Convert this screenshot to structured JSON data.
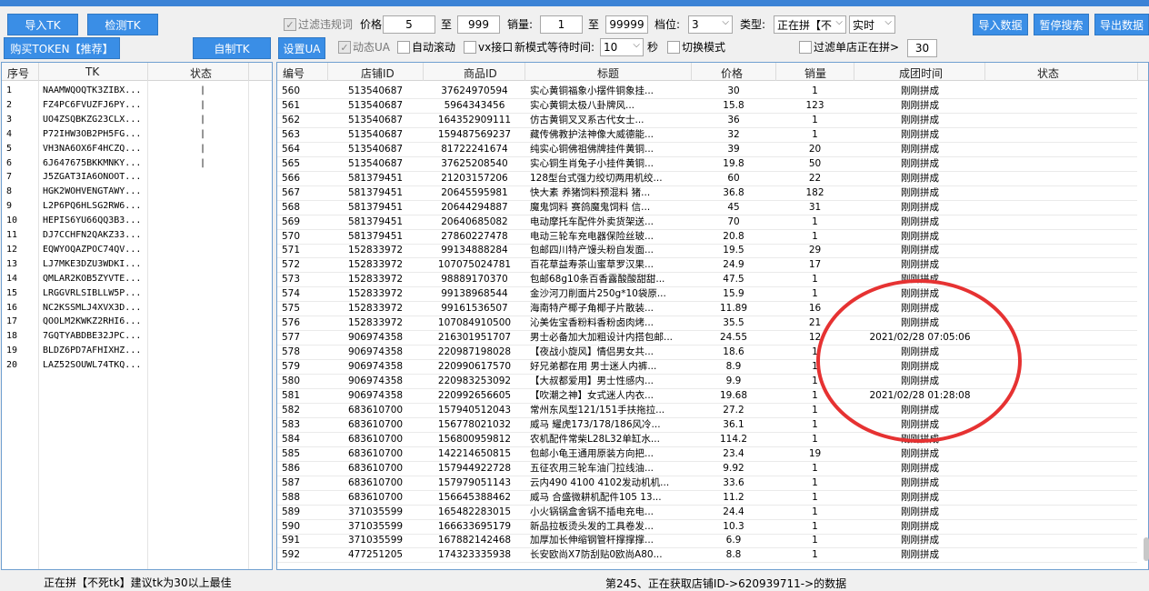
{
  "toolbar": {
    "import_tk": "导入TK",
    "check_tk": "检测TK",
    "buy_token": "购买TOKEN【推荐】",
    "make_tk": "自制TK",
    "filter_illegal": "过滤违规词",
    "price_label": "价格:",
    "price_min": "5",
    "to1": "至",
    "price_max": "999",
    "sales_label": "销量:",
    "sales_min": "1",
    "to2": "至",
    "sales_max": "99999",
    "level_label": "档位:",
    "level_value": "3",
    "type_label": "类型:",
    "type_value": "正在拼【不",
    "mode_value": "实时",
    "import_data": "导入数据",
    "pause_search": "暂停搜索",
    "export_data": "导出数据",
    "set_ua": "设置UA",
    "dynamic_ua": "动态UA",
    "auto_scroll": "自动滚动",
    "vx_api": "vx接口",
    "new_mode_wait": "新模式等待时间:",
    "wait_value": "10",
    "seconds": "秒",
    "switch_mode": "切换模式",
    "filter_shop": "过滤单店正在拼>",
    "filter_shop_value": "30"
  },
  "left_table": {
    "headers": [
      "序号",
      "TK",
      "状态"
    ],
    "rows": [
      {
        "no": "1",
        "tk": "NAAMWQOQTK3ZIBX...",
        "status": "|"
      },
      {
        "no": "2",
        "tk": "FZ4PC6FVUZFJ6PY...",
        "status": "|"
      },
      {
        "no": "3",
        "tk": "UO4ZSQBKZG23CLX...",
        "status": "|"
      },
      {
        "no": "4",
        "tk": "P72IHW3OB2PH5FG...",
        "status": "|"
      },
      {
        "no": "5",
        "tk": "VH3NA6OX6F4HCZQ...",
        "status": "|"
      },
      {
        "no": "6",
        "tk": "6J647675BKKMNKY...",
        "status": "|"
      },
      {
        "no": "7",
        "tk": "J5ZGAT3IA6ONOOT...",
        "status": ""
      },
      {
        "no": "8",
        "tk": "HGK2WOHVENGTAWY...",
        "status": ""
      },
      {
        "no": "9",
        "tk": "L2P6PQ6HLSG2RW6...",
        "status": ""
      },
      {
        "no": "10",
        "tk": "HEPIS6YU66QQ3B3...",
        "status": ""
      },
      {
        "no": "11",
        "tk": "DJ7CCHFN2QAKZ33...",
        "status": ""
      },
      {
        "no": "12",
        "tk": "EQWYOQAZPOC74QV...",
        "status": ""
      },
      {
        "no": "13",
        "tk": "LJ7MKE3DZU3WDKI...",
        "status": ""
      },
      {
        "no": "14",
        "tk": "QMLAR2KOB5ZYVTE...",
        "status": ""
      },
      {
        "no": "15",
        "tk": "LRGGVRLSIBLLW5P...",
        "status": ""
      },
      {
        "no": "16",
        "tk": "NC2KSSMLJ4XVX3D...",
        "status": ""
      },
      {
        "no": "17",
        "tk": "QOOLM2KWKZ2RHI6...",
        "status": ""
      },
      {
        "no": "18",
        "tk": "7GQTYABDBE32JPC...",
        "status": ""
      },
      {
        "no": "19",
        "tk": "BLDZ6PD7AFHIXHZ...",
        "status": ""
      },
      {
        "no": "20",
        "tk": "LAZ52SOUWL74TKQ...",
        "status": ""
      }
    ]
  },
  "right_table": {
    "headers": [
      "编号",
      "店铺ID",
      "商品ID",
      "标题",
      "价格",
      "销量",
      "成团时间",
      "状态"
    ],
    "rows": [
      {
        "no": "560",
        "shop": "513540687",
        "goods": "37624970594",
        "title": "实心黄铜福象小摆件铜象挂...",
        "price": "30",
        "sales": "1",
        "time": "刚刚拼成"
      },
      {
        "no": "561",
        "shop": "513540687",
        "goods": "5964343456",
        "title": "实心黄铜太极八卦牌风...",
        "price": "15.8",
        "sales": "123",
        "time": "刚刚拼成"
      },
      {
        "no": "562",
        "shop": "513540687",
        "goods": "164352909111",
        "title": "仿古黄铜叉叉系古代女士...",
        "price": "36",
        "sales": "1",
        "time": "刚刚拼成"
      },
      {
        "no": "563",
        "shop": "513540687",
        "goods": "159487569237",
        "title": "藏传佛教护法神像大威德能...",
        "price": "32",
        "sales": "1",
        "time": "刚刚拼成"
      },
      {
        "no": "564",
        "shop": "513540687",
        "goods": "81722241674",
        "title": "纯实心铜佛祖佛牌挂件黄铜...",
        "price": "39",
        "sales": "20",
        "time": "刚刚拼成"
      },
      {
        "no": "565",
        "shop": "513540687",
        "goods": "37625208540",
        "title": "实心铜生肖兔子小挂件黄铜...",
        "price": "19.8",
        "sales": "50",
        "time": "刚刚拼成"
      },
      {
        "no": "566",
        "shop": "581379451",
        "goods": "21203157206",
        "title": "128型台式强力绞切两用机绞...",
        "price": "60",
        "sales": "22",
        "time": "刚刚拼成"
      },
      {
        "no": "567",
        "shop": "581379451",
        "goods": "20645595981",
        "title": "快大素 养猪饲料预混料 猪...",
        "price": "36.8",
        "sales": "182",
        "time": "刚刚拼成"
      },
      {
        "no": "568",
        "shop": "581379451",
        "goods": "20644294887",
        "title": "魔鬼饲料 赛鸽魔鬼饲料 信...",
        "price": "45",
        "sales": "31",
        "time": "刚刚拼成"
      },
      {
        "no": "569",
        "shop": "581379451",
        "goods": "20640685082",
        "title": "电动摩托车配件外卖货架送...",
        "price": "70",
        "sales": "1",
        "time": "刚刚拼成"
      },
      {
        "no": "570",
        "shop": "581379451",
        "goods": "27860227478",
        "title": "电动三轮车充电器保险丝玻...",
        "price": "20.8",
        "sales": "1",
        "time": "刚刚拼成"
      },
      {
        "no": "571",
        "shop": "152833972",
        "goods": "99134888284",
        "title": "包邮四川特产馒头粉自发面...",
        "price": "19.5",
        "sales": "29",
        "time": "刚刚拼成"
      },
      {
        "no": "572",
        "shop": "152833972",
        "goods": "107075024781",
        "title": "百花草益寿茶山蜜草罗汉果...",
        "price": "24.9",
        "sales": "17",
        "time": "刚刚拼成"
      },
      {
        "no": "573",
        "shop": "152833972",
        "goods": "98889170370",
        "title": "包邮68g10条百香露酸酸甜甜...",
        "price": "47.5",
        "sales": "1",
        "time": "刚刚拼成"
      },
      {
        "no": "574",
        "shop": "152833972",
        "goods": "99138968544",
        "title": "金沙河刀削面片250g*10袋原...",
        "price": "15.9",
        "sales": "1",
        "time": "刚刚拼成"
      },
      {
        "no": "575",
        "shop": "152833972",
        "goods": "99161536507",
        "title": "海南特产椰子角椰子片散装...",
        "price": "11.89",
        "sales": "16",
        "time": "刚刚拼成"
      },
      {
        "no": "576",
        "shop": "152833972",
        "goods": "107084910500",
        "title": "沁美佐宝香粉料香粉卤肉烤...",
        "price": "35.5",
        "sales": "21",
        "time": "刚刚拼成"
      },
      {
        "no": "577",
        "shop": "906974358",
        "goods": "216301951707",
        "title": "男士必备加大加粗设计内搭包邮...",
        "price": "24.55",
        "sales": "12",
        "time": "2021/02/28 07:05:06"
      },
      {
        "no": "578",
        "shop": "906974358",
        "goods": "220987198028",
        "title": "【夜战小旋风】情侣男女共...",
        "price": "18.6",
        "sales": "1",
        "time": "刚刚拼成"
      },
      {
        "no": "579",
        "shop": "906974358",
        "goods": "220990617570",
        "title": "好兄弟都在用 男士迷人内裤...",
        "price": "8.9",
        "sales": "1",
        "time": "刚刚拼成"
      },
      {
        "no": "580",
        "shop": "906974358",
        "goods": "220983253092",
        "title": "【大叔都爱用】男士性感内...",
        "price": "9.9",
        "sales": "1",
        "time": "刚刚拼成"
      },
      {
        "no": "581",
        "shop": "906974358",
        "goods": "220992656605",
        "title": "【吹潮之神】女式迷人内衣...",
        "price": "19.68",
        "sales": "1",
        "time": "2021/02/28 01:28:08"
      },
      {
        "no": "582",
        "shop": "683610700",
        "goods": "157940512043",
        "title": "常州东风型121/151手扶拖拉...",
        "price": "27.2",
        "sales": "1",
        "time": "刚刚拼成"
      },
      {
        "no": "583",
        "shop": "683610700",
        "goods": "156778021032",
        "title": "威马 耀虎173/178/186风冷...",
        "price": "36.1",
        "sales": "1",
        "time": "刚刚拼成"
      },
      {
        "no": "584",
        "shop": "683610700",
        "goods": "156800959812",
        "title": "农机配件常柴L28L32单缸水...",
        "price": "114.2",
        "sales": "1",
        "time": "刚刚拼成"
      },
      {
        "no": "585",
        "shop": "683610700",
        "goods": "142214650815",
        "title": "包邮小龟王通用原装方向把...",
        "price": "23.4",
        "sales": "19",
        "time": "刚刚拼成"
      },
      {
        "no": "586",
        "shop": "683610700",
        "goods": "157944922728",
        "title": "五征农用三轮车油门拉线油...",
        "price": "9.92",
        "sales": "1",
        "time": "刚刚拼成"
      },
      {
        "no": "587",
        "shop": "683610700",
        "goods": "157979051143",
        "title": "云内490 4100 4102发动机机...",
        "price": "33.6",
        "sales": "1",
        "time": "刚刚拼成"
      },
      {
        "no": "588",
        "shop": "683610700",
        "goods": "156645388462",
        "title": "威马 合盛微耕机配件105 13...",
        "price": "11.2",
        "sales": "1",
        "time": "刚刚拼成"
      },
      {
        "no": "589",
        "shop": "371035599",
        "goods": "165482283015",
        "title": "小火锅锅盒舍锅不插电充电...",
        "price": "24.4",
        "sales": "1",
        "time": "刚刚拼成"
      },
      {
        "no": "590",
        "shop": "371035599",
        "goods": "166633695179",
        "title": "新品拉板烫头发的工具卷发...",
        "price": "10.3",
        "sales": "1",
        "time": "刚刚拼成"
      },
      {
        "no": "591",
        "shop": "371035599",
        "goods": "167882142468",
        "title": "加厚加长伸缩钢管杆撑撑撑...",
        "price": "6.9",
        "sales": "1",
        "time": "刚刚拼成"
      },
      {
        "no": "592",
        "shop": "477251205",
        "goods": "174323335938",
        "title": "长安欧尚X7防刮贴0欧尚A80...",
        "price": "8.8",
        "sales": "1",
        "time": "刚刚拼成"
      }
    ]
  },
  "status_bar": {
    "left": "正在拼【不死tk】建议tk为30以上最佳",
    "right": "第245、正在获取店铺ID->620939711->的数据"
  },
  "colors": {
    "button_blue": "#3a8ee6",
    "top_strip": "#3c83d6",
    "annotation_red": "#e63232"
  }
}
